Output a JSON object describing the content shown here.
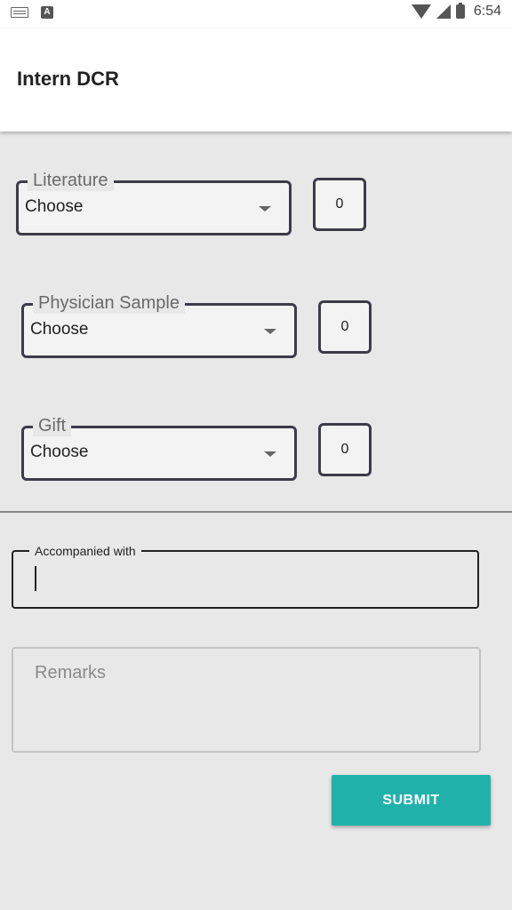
{
  "status_bar": {
    "time": "6:54",
    "icons": [
      "keyboard-icon",
      "a-icon",
      "wifi-icon",
      "signal-icon",
      "battery-icon"
    ]
  },
  "app_bar": {
    "title": "Intern DCR"
  },
  "form": {
    "rows": [
      {
        "label": "Literature",
        "selected": "Choose",
        "quantity": "0"
      },
      {
        "label": "Physician Sample",
        "selected": "Choose",
        "quantity": "0"
      },
      {
        "label": "Gift",
        "selected": "Choose",
        "quantity": "0"
      }
    ],
    "accompanied": {
      "label": "Accompanied with",
      "value": ""
    },
    "remarks": {
      "placeholder": "Remarks"
    },
    "submit_label": "SUBMIT"
  },
  "colors": {
    "accent": "#20b2aa",
    "background": "#e8e8e8",
    "field_border": "#3c3c48"
  }
}
